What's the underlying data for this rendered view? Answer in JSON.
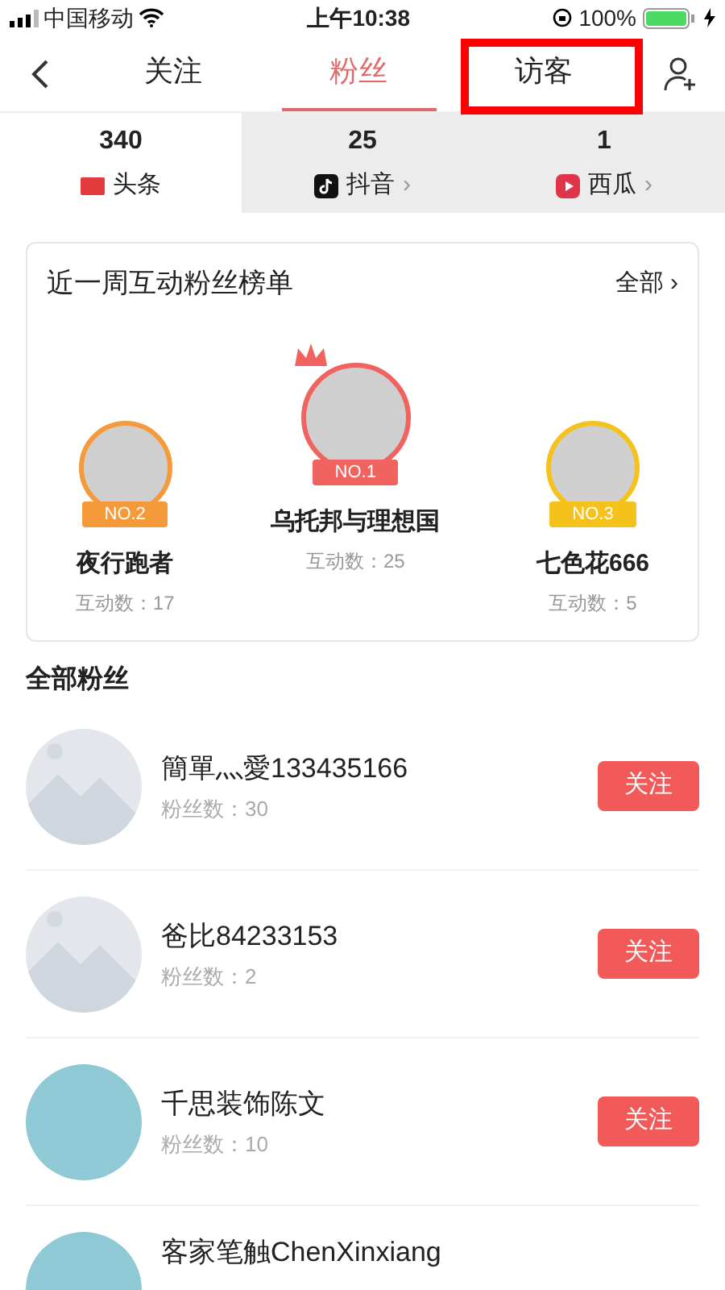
{
  "status_bar": {
    "carrier": "中国移动",
    "time": "上午10:38",
    "battery": "100%"
  },
  "tabs": [
    {
      "label": "关注",
      "selected": false,
      "highlighted": false
    },
    {
      "label": "粉丝",
      "selected": true,
      "highlighted": false
    },
    {
      "label": "访客",
      "selected": false,
      "highlighted": true
    }
  ],
  "stats": [
    {
      "count": "340",
      "platform": "头条",
      "kind": "toutiao",
      "selected": true
    },
    {
      "count": "25",
      "platform": "抖音",
      "kind": "douyin",
      "chevron": "›",
      "selected": false
    },
    {
      "count": "1",
      "platform": "西瓜",
      "kind": "xigua",
      "chevron": "›",
      "selected": false
    }
  ],
  "ranking": {
    "title": "近一周互动粉丝榜单",
    "more": "全部 ›",
    "podium": [
      {
        "rank": "NO.2",
        "name": "夜行跑者",
        "count": "互动数：17",
        "color": "#f59a3b",
        "kind": "side"
      },
      {
        "rank": "NO.1",
        "name": "乌托邦与理想国",
        "count": "互动数：25",
        "color": "#f0635f",
        "kind": "top"
      },
      {
        "rank": "NO.3",
        "name": "七色花666",
        "count": "互动数：5",
        "color": "#f5c21b",
        "kind": "side"
      }
    ]
  },
  "fans_title": "全部粉丝",
  "fans": [
    {
      "name": "簡單灬愛133435166",
      "count": "粉丝数：30",
      "button": "关注",
      "kind": "placeholder"
    },
    {
      "name": "爸比84233153",
      "count": "粉丝数：2",
      "button": "关注",
      "kind": "placeholder"
    },
    {
      "name": "千思装饰陈文",
      "count": "粉丝数：10",
      "button": "关注",
      "kind": "photo"
    },
    {
      "name": "客家笔触ChenXinxiang",
      "kind": "photo"
    }
  ]
}
